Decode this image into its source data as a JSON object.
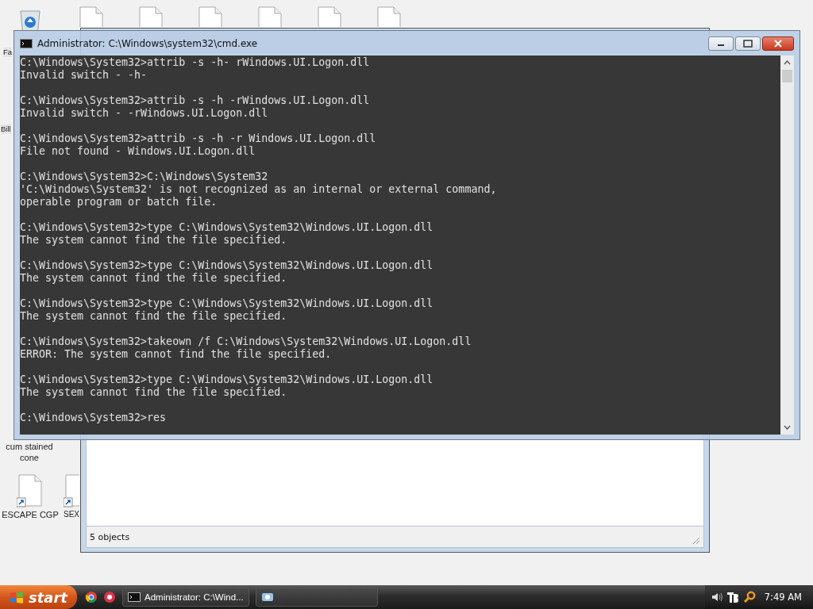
{
  "desktop": {
    "partial_labels": [
      "Fa",
      "Bill"
    ],
    "icons": [
      {
        "kind": "recycle"
      },
      {
        "kind": "file"
      },
      {
        "kind": "file"
      },
      {
        "kind": "file"
      },
      {
        "kind": "file"
      },
      {
        "kind": "file"
      },
      {
        "kind": "file"
      },
      {
        "kind": "label",
        "label": "cum stained cone"
      },
      {
        "kind": "shortcut",
        "label": "ESCAPE CGP"
      },
      {
        "kind": "shortcut_edge",
        "label": "SEX"
      }
    ]
  },
  "back_window": {
    "status": "5 objects"
  },
  "console": {
    "title": "Administrator: C:\\Windows\\system32\\cmd.exe",
    "blocks": [
      {
        "lines": [
          "C:\\Windows\\System32>attrib -s -h- rWindows.UI.Logon.dll",
          "Invalid switch - -h-"
        ]
      },
      {
        "lines": [
          "C:\\Windows\\System32>attrib -s -h -rWindows.UI.Logon.dll",
          "Invalid switch - -rWindows.UI.Logon.dll"
        ]
      },
      {
        "lines": [
          "C:\\Windows\\System32>attrib -s -h -r Windows.UI.Logon.dll",
          "File not found - Windows.UI.Logon.dll"
        ]
      },
      {
        "lines": [
          "C:\\Windows\\System32>C:\\Windows\\System32",
          "'C:\\Windows\\System32' is not recognized as an internal or external command,",
          "operable program or batch file."
        ]
      },
      {
        "lines": [
          "C:\\Windows\\System32>type C:\\Windows\\System32\\Windows.UI.Logon.dll",
          "The system cannot find the file specified."
        ]
      },
      {
        "lines": [
          "C:\\Windows\\System32>type C:\\Windows\\System32\\Windows.UI.Logon.dll",
          "The system cannot find the file specified."
        ]
      },
      {
        "lines": [
          "C:\\Windows\\System32>type C:\\Windows\\System32\\Windows.UI.Logon.dll",
          "The system cannot find the file specified."
        ]
      },
      {
        "lines": [
          "C:\\Windows\\System32>takeown /f C:\\Windows\\System32\\Windows.UI.Logon.dll",
          "ERROR: The system cannot find the file specified."
        ]
      },
      {
        "lines": [
          "C:\\Windows\\System32>type C:\\Windows\\System32\\Windows.UI.Logon.dll",
          "The system cannot find the file specified."
        ]
      },
      {
        "lines": [
          "C:\\Windows\\System32>res"
        ]
      }
    ]
  },
  "taskbar": {
    "start": "start",
    "quick_launch": [
      {
        "kind": "chrome"
      },
      {
        "kind": "record"
      }
    ],
    "tasks": [
      {
        "kind": "console",
        "label": "Administrator: C:\\Wind..."
      },
      {
        "kind": "search"
      }
    ],
    "clock": "7:49 AM"
  }
}
